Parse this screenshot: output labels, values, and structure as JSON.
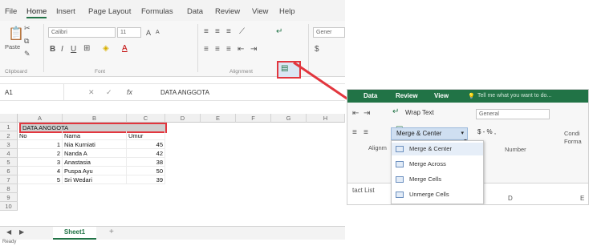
{
  "menu": [
    "File",
    "Home",
    "Insert",
    "Page Layout",
    "Formulas",
    "Data",
    "Review",
    "View",
    "Help"
  ],
  "ribbon": {
    "paste": "Paste",
    "font_name": "Calibri",
    "font_size": "11",
    "font_grow": "A",
    "font_shrink": "A",
    "number_format": "Gener",
    "currency": "$",
    "groups": [
      "Clipboard",
      "Font",
      "Alignment"
    ]
  },
  "formula_bar": {
    "cell_ref": "A1",
    "fx": "fx",
    "value": "DATA ANGGOTA"
  },
  "columns": [
    "A",
    "B",
    "C",
    "D",
    "E",
    "F",
    "G",
    "H"
  ],
  "rows": [
    "1",
    "2",
    "3",
    "4",
    "5",
    "6",
    "7",
    "8",
    "9",
    "10"
  ],
  "table": {
    "title": "DATA ANGGOTA",
    "headers": [
      "No",
      "Nama",
      "Umur"
    ],
    "data": [
      [
        "1",
        "Nia Kurniati",
        "45"
      ],
      [
        "2",
        "Nanda A",
        "42"
      ],
      [
        "3",
        "Anastasia",
        "38"
      ],
      [
        "4",
        "Puspa Ayu",
        "50"
      ],
      [
        "5",
        "Sri Wedari",
        "39"
      ]
    ]
  },
  "sheet_tab": "Sheet1",
  "add_sheet": "+",
  "status": "Ready",
  "zoom": {
    "tabs": [
      "Data",
      "Review",
      "View"
    ],
    "tell_me": "Tell me what you want to do...",
    "wrap_text": "Wrap Text",
    "merge_center": "Merge & Center",
    "number_format": "General",
    "number_symbols": "$ - % ,",
    "group_label": "Number",
    "alignment_label": "Alignm",
    "cond_format": "Condi",
    "format_label": "Forma",
    "left_text": "tact List",
    "menu": [
      "Merge & Center",
      "Merge Across",
      "Merge Cells",
      "Unmerge Cells"
    ],
    "col_d": "D",
    "col_e": "E"
  },
  "colors": {
    "excel_green": "#217346",
    "highlight_red": "#e2363e",
    "selection_blue": "#cfdff1"
  }
}
